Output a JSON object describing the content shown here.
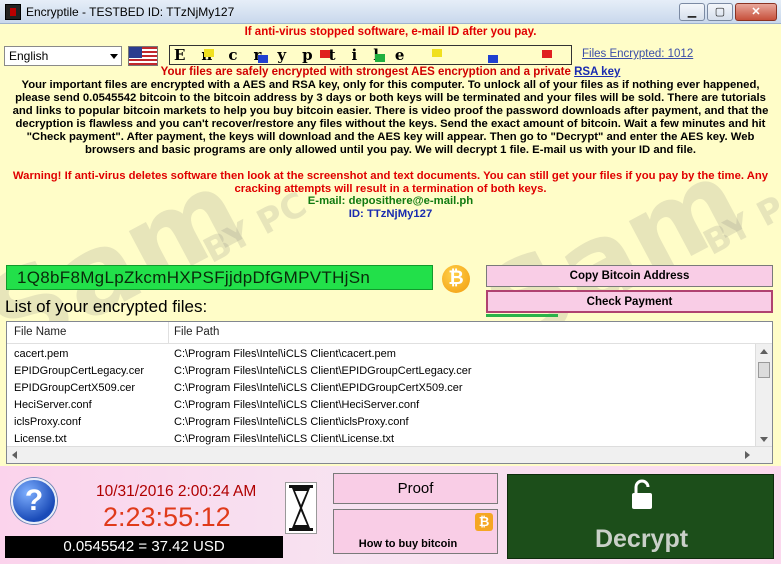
{
  "window": {
    "title": "Encryptile -   TESTBED ID: TTzNjMy127",
    "min_symbol": "▁",
    "max_symbol": "▢",
    "close_symbol": "✕"
  },
  "header": {
    "warning_top": "If anti-virus stopped software, e-mail ID after you pay.",
    "language": "English",
    "logo_text": "Encryptile",
    "files_encrypted": "Files Encrypted: 1012",
    "subtitle": "Your files are safely encrypted with strongest AES encryption and a private",
    "subtitle_link": "RSA key"
  },
  "message": {
    "body": "Your important files are encrypted with a AES and RSA key, only for this computer. To unlock all of your files as if nothing ever happened, please send 0.0545542 bitcoin to the bitcoin address by 3 days or both keys will be terminated and your files will be sold. There are tutorials and links to popular bitcoin markets to help you buy bitcoin easier. There is video proof the password downloads after payment, and that the decryption is flawless and you can't recover/restore any files without the keys. Send the exact amount of bitcoin. Wait a few minutes and hit \"Check payment\". After payment, the keys will download and the AES key will appear. Then go to \"Decrypt\" and enter the AES key. Web browsers and basic programs are only allowed until you pay. We will decrypt 1 file. E-mail us with your ID and file.",
    "warning": "Warning! If anti-virus deletes software then look at the screenshot and text documents. You can still get your files if you pay by the time. Any cracking attempts will result in a termination of both keys.",
    "email": "E-mail:  deposithere@e-mail.ph",
    "id": "ID:  TTzNjMy127"
  },
  "bitcoin": {
    "address": "1Q8bF8MgLpZkcmHXPSFjjdpDfGMPVTHjSn",
    "coin_symbol": "₿",
    "copy_label": "Copy Bitcoin Address",
    "check_label": "Check Payment",
    "check_progress": 0.25
  },
  "file_list": {
    "heading": "List of your encrypted files:",
    "columns": [
      "File Name",
      "File Path"
    ],
    "rows": [
      {
        "name": "cacert.pem",
        "path": "C:\\Program Files\\Intel\\iCLS Client\\cacert.pem"
      },
      {
        "name": "EPIDGroupCertLegacy.cer",
        "path": "C:\\Program Files\\Intel\\iCLS Client\\EPIDGroupCertLegacy.cer"
      },
      {
        "name": "EPIDGroupCertX509.cer",
        "path": "C:\\Program Files\\Intel\\iCLS Client\\EPIDGroupCertX509.cer"
      },
      {
        "name": "HeciServer.conf",
        "path": "C:\\Program Files\\Intel\\iCLS Client\\HeciServer.conf"
      },
      {
        "name": "iclsProxy.conf",
        "path": "C:\\Program Files\\Intel\\iCLS Client\\iclsProxy.conf"
      },
      {
        "name": "License.txt",
        "path": "C:\\Program Files\\Intel\\iCLS Client\\License.txt"
      }
    ]
  },
  "timer": {
    "datetime": "10/31/2016 2:00:24 AM",
    "countdown": "2:23:55:12",
    "amount": "0.0545542 = 37.42 USD",
    "help_symbol": "?"
  },
  "actions": {
    "proof_label": "Proof",
    "howto_label": "How to buy bitcoin",
    "howto_icon": "₿",
    "decrypt_label": "Decrypt"
  },
  "watermark": {
    "text": "Sam",
    "sub": "BY PC"
  },
  "colors": {
    "background": "#fffdc8",
    "warning_red": "#e00000",
    "address_green": "#22e04a",
    "button_pink": "#f9cde6",
    "decrypt_green": "#1c4e1a"
  }
}
